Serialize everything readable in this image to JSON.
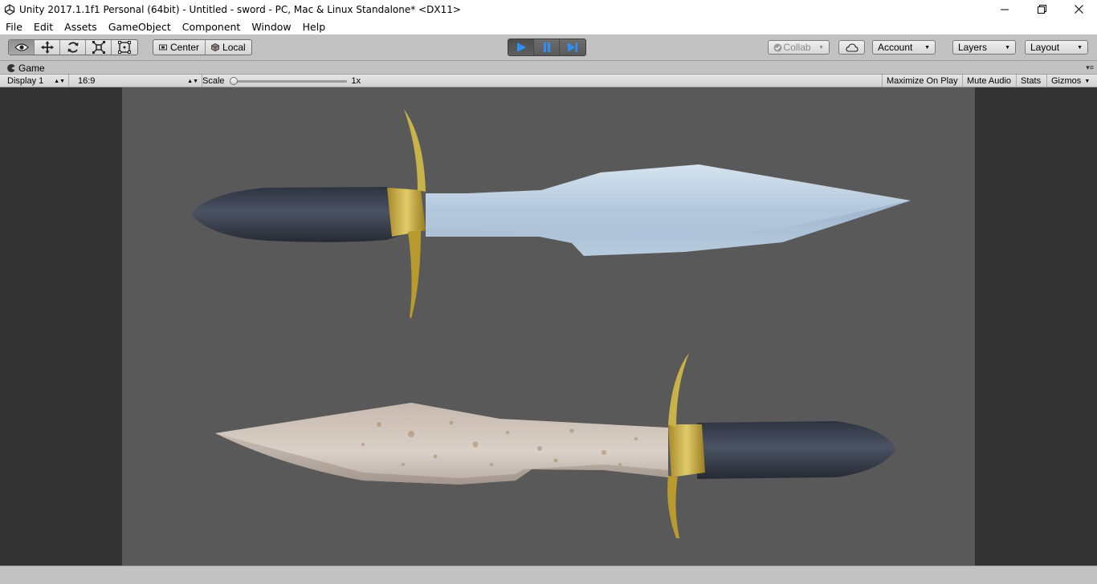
{
  "window": {
    "title": "Unity 2017.1.1f1 Personal (64bit) - Untitled - sword - PC, Mac & Linux Standalone* <DX11>",
    "icon": "unity-logo-icon",
    "controls": [
      "minimize-icon",
      "restore-icon",
      "close-icon"
    ]
  },
  "menu": {
    "items": [
      "File",
      "Edit",
      "Assets",
      "GameObject",
      "Component",
      "Window",
      "Help"
    ]
  },
  "toolbar": {
    "transform_tools": [
      "view-eye-icon",
      "move-icon",
      "rotate-icon",
      "scale-icon",
      "rect-tool-icon"
    ],
    "pivot": {
      "center_label": "Center",
      "local_label": "Local"
    },
    "play_controls": [
      "play-icon",
      "pause-icon",
      "step-icon"
    ],
    "collab_label": "Collab",
    "account_label": "Account",
    "layers_label": "Layers",
    "layout_label": "Layout"
  },
  "game_view": {
    "tab_label": "Game",
    "display_label": "Display 1",
    "aspect_label": "16:9",
    "scale_label": "Scale",
    "scale_value": "1x",
    "scale_slider_fraction": 0.0,
    "toggles": [
      "Maximize On Play",
      "Mute Audio",
      "Stats",
      "Gizmos"
    ]
  },
  "colors": {
    "chrome": "#c2c2c2",
    "letterbox": "#333333",
    "scene_background": "#5a5959",
    "play_active": "#1e6fd9",
    "blade": "#b9cde0",
    "guard": "#c8a83a",
    "handle": "#3d4350"
  }
}
